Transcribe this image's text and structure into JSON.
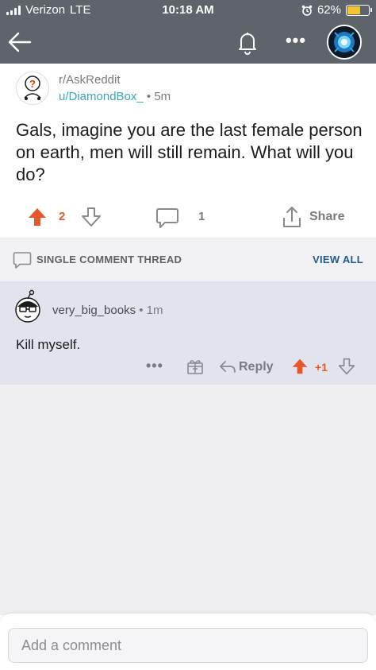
{
  "status_bar": {
    "carrier": "Verizon",
    "network": "LTE",
    "time": "10:18 AM",
    "battery": "62%",
    "battery_level": 0.62
  },
  "header": {
    "icons": [
      "back-arrow-icon",
      "bell-icon",
      "more-dots-icon",
      "user-avatar"
    ],
    "more_label": "•••"
  },
  "post": {
    "subreddit": "r/AskReddit",
    "author": "u/DiamondBox_",
    "separator": "•",
    "age": "5m",
    "title": "Gals, imagine you are the last female person on earth, men will still remain. What will you do?",
    "votes": "2",
    "comments": "1",
    "share_label": "Share"
  },
  "thread": {
    "label": "SINGLE COMMENT THREAD",
    "view_all": "VIEW ALL"
  },
  "comment": {
    "username": "very_big_books",
    "meta": "• 1m",
    "body": "Kill myself.",
    "more_label": "•••",
    "reply_label": "Reply",
    "score": "+1"
  },
  "compose": {
    "placeholder": "Add a comment"
  },
  "colors": {
    "header_bg": "#5f646b",
    "upvote": "#e4582e",
    "link": "#3aa6b9",
    "view_all": "#25598f",
    "comment_bg": "#e1e4ec"
  }
}
